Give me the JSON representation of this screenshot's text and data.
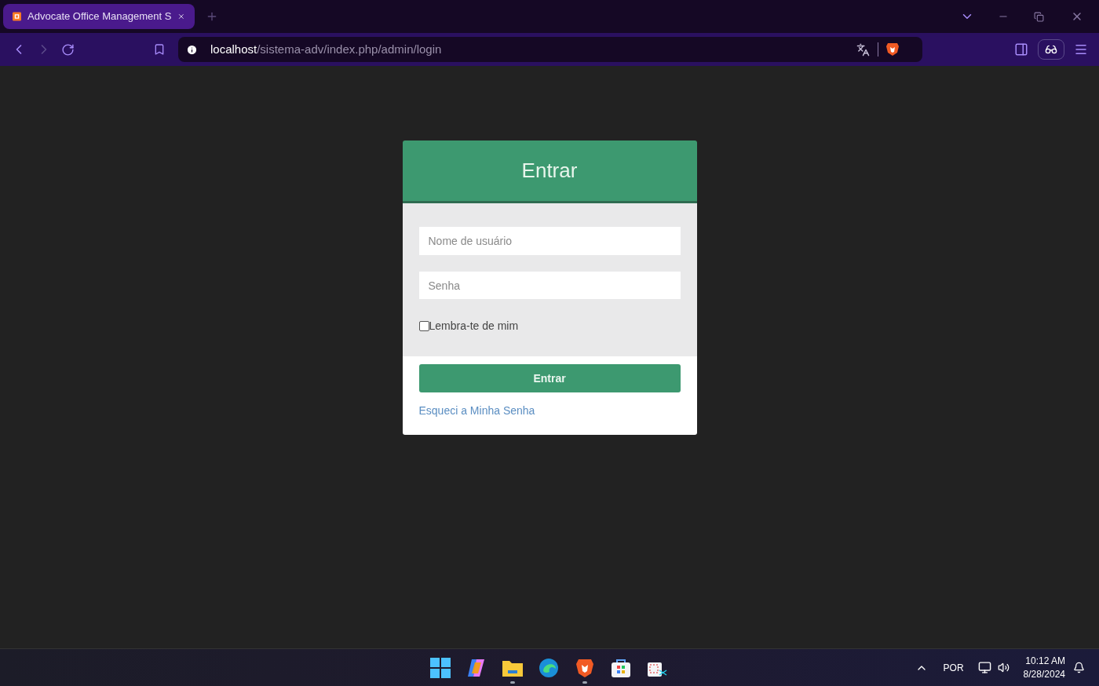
{
  "browser": {
    "tab": {
      "title": "Advocate Office Management S",
      "selected": true
    },
    "address": {
      "host": "localhost",
      "path": "/sistema-adv/index.php/admin/login"
    }
  },
  "login": {
    "title": "Entrar",
    "username": {
      "placeholder": "Nome de usuário"
    },
    "password": {
      "placeholder": "Senha"
    },
    "remember": {
      "label": "Lembra-te de mim",
      "checked": false
    },
    "submit": "Entrar",
    "forgot": "Esqueci a Minha Senha"
  },
  "taskbar": {
    "apps": [
      {
        "kind": "start",
        "running": false
      },
      {
        "kind": "copilot",
        "running": false
      },
      {
        "kind": "folder",
        "running": true
      },
      {
        "kind": "edge",
        "running": false
      },
      {
        "kind": "brave",
        "running": true
      },
      {
        "kind": "store",
        "running": false
      },
      {
        "kind": "snip",
        "running": false
      }
    ],
    "language": "POR",
    "time": "10:12 AM",
    "date": "8/28/2024"
  }
}
